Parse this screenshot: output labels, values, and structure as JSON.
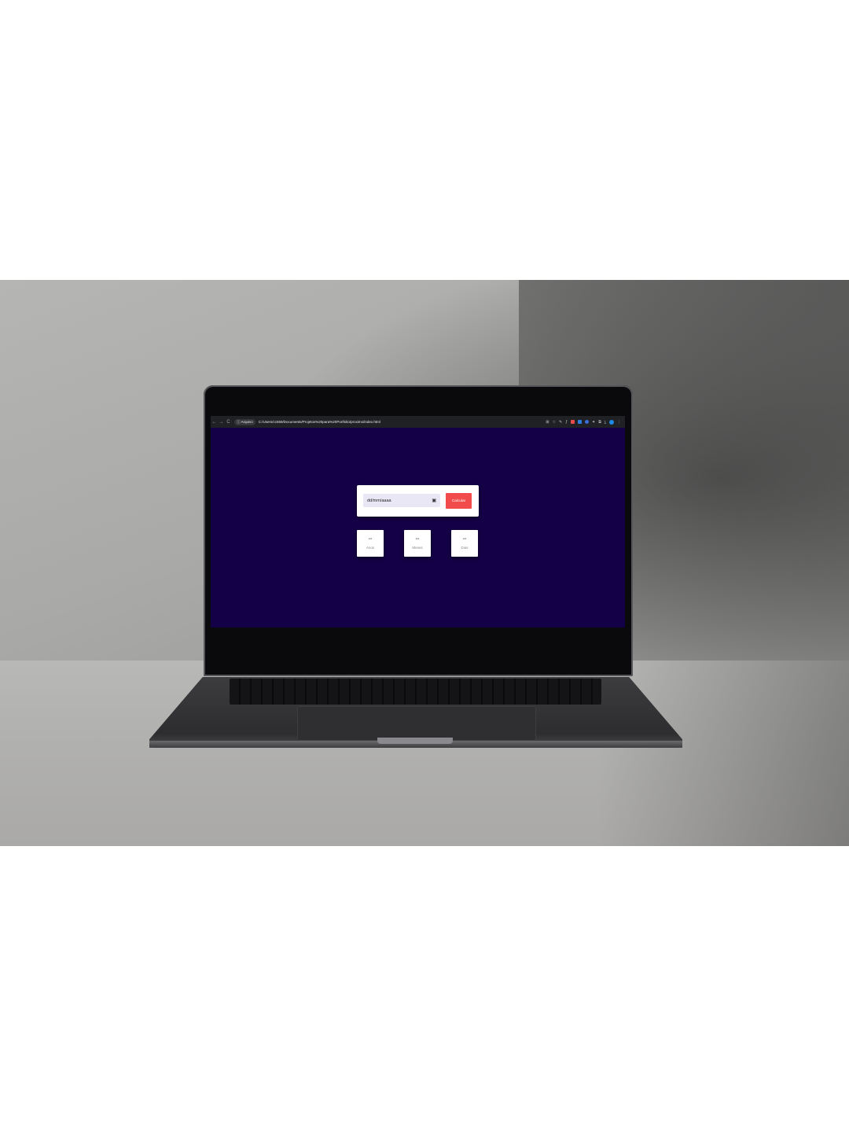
{
  "browser": {
    "secure_chip_label": "Arquivo",
    "url": "C:/Users/cc559/Documents/Projetos%20para%20Portfolio/proximo/index.html",
    "nav_back": "←",
    "nav_forward": "→",
    "nav_reload": "C"
  },
  "app": {
    "date_placeholder": "dd/mm/aaaa",
    "calendar_glyph": "▣",
    "calculate_label": "Calcular",
    "results": [
      {
        "value": "--",
        "label": "Anos"
      },
      {
        "value": "--",
        "label": "Meses"
      },
      {
        "value": "--",
        "label": "Dias"
      }
    ]
  },
  "colors": {
    "page_bg": "#140046",
    "button": "#f24b4b",
    "card": "#ffffff"
  }
}
